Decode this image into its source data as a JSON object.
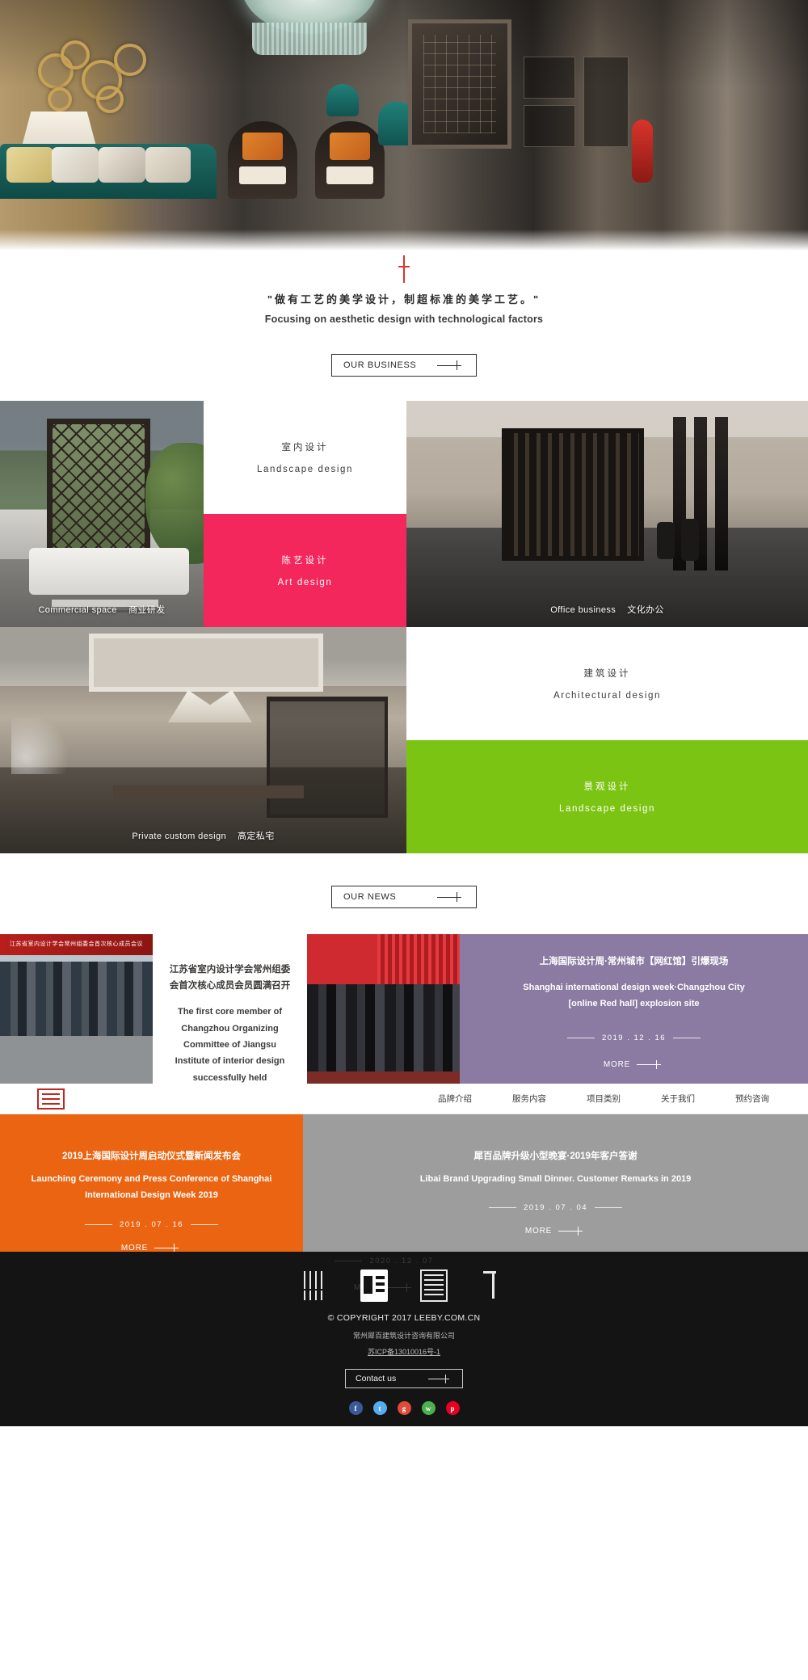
{
  "hero": {
    "alt": "luxury chinese interior living room"
  },
  "tagline": {
    "cn": "\"做有工艺的美学设计，制超标准的美学工艺。\"",
    "en": "Focusing on aesthetic design with technological factors"
  },
  "sections": {
    "business_button": "OUR BUSINESS",
    "news_button": "OUR NEWS"
  },
  "business": {
    "cells": [
      {
        "name": "garden-photo",
        "en": "Commercial space",
        "cn": "商业研发",
        "kind": "photo"
      },
      {
        "name": "interior-text",
        "en": "Landscape design",
        "cn": "室内设计",
        "kind": "text-light"
      },
      {
        "name": "art-text",
        "en": "Art design",
        "cn": "陈艺设计",
        "kind": "text-pink"
      },
      {
        "name": "office-photo",
        "en": "Office business",
        "cn": "文化办公",
        "kind": "photo"
      },
      {
        "name": "private-photo",
        "en": "Private custom design",
        "cn": "高定私宅",
        "kind": "photo"
      },
      {
        "name": "architectural-text",
        "en": "Architectural design",
        "cn": "建筑设计",
        "kind": "text-light"
      },
      {
        "name": "landscape-text",
        "en": "Landscape design",
        "cn": "景观设计",
        "kind": "text-green"
      }
    ]
  },
  "news": [
    {
      "name": "news-jiangsu",
      "cn": "江苏省室内设计学会常州组委会首次核心成员会员圆满召开",
      "en": "The first core member of Changzhou Organizing Committee of Jiangsu Institute of interior design successfully held",
      "date": "2020 . 12 . 07",
      "more": "MORE"
    },
    {
      "name": "news-shanghai-week",
      "cn": "上海国际设计周·常州城市【网红馆】引爆现场",
      "en": "Shanghai international design week·Changzhou City [online Red hall] explosion site",
      "date": "2019 . 12 . 16",
      "more": "MORE"
    },
    {
      "name": "news-launch-ceremony",
      "cn": "2019上海国际设计周启动仪式暨新闻发布会",
      "en": "Launching Ceremony and Press Conference of Shanghai International Design Week 2019",
      "date": "2019 . 07 . 16",
      "more": "MORE"
    },
    {
      "name": "news-libai-dinner",
      "cn": "犀百品牌升级小型晚宴·2019年客户答谢",
      "en": "Libai Brand Upgrading Small Dinner. Customer Remarks in 2019",
      "date": "2019 . 07 . 04",
      "more": "MORE"
    }
  ],
  "nav": {
    "logo": "brand-logo",
    "items": [
      {
        "label": "品牌介绍"
      },
      {
        "label": "服务内容"
      },
      {
        "label": "项目类别"
      },
      {
        "label": "关于我们"
      },
      {
        "label": "预约咨询"
      }
    ]
  },
  "footer": {
    "copyright": "© COPYRIGHT 2017 LEEBY.COM.CN",
    "company": "常州犀百建筑设计咨询有限公司",
    "icp": "苏ICP备13010016号-1",
    "contact_button": "Contact us",
    "social": [
      {
        "name": "facebook",
        "glyph": "f",
        "color": "#3b5998"
      },
      {
        "name": "twitter",
        "glyph": "t",
        "color": "#55acee"
      },
      {
        "name": "google-plus",
        "glyph": "g",
        "color": "#dd4b39"
      },
      {
        "name": "wechat",
        "glyph": "w",
        "color": "#4caf50"
      },
      {
        "name": "pinterest",
        "glyph": "p",
        "color": "#e60023"
      }
    ]
  },
  "colors": {
    "pink": "#f4275d",
    "green": "#7cc413",
    "purple": "#8b7ba3",
    "orange": "#eb6412",
    "grey": "#9d9d9d",
    "red_accent": "#c0261f"
  }
}
